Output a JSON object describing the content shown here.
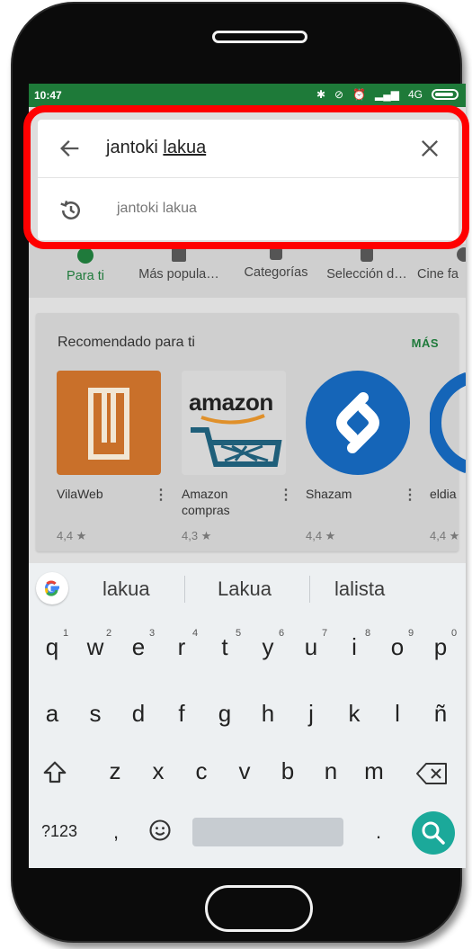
{
  "status_bar": {
    "time": "10:47",
    "network": "4G"
  },
  "search": {
    "query_prefix": "jantoki ",
    "query_underlined": "lakua",
    "suggestion": "jantoki lakua"
  },
  "tabs": [
    "Para ti",
    "Más popula…",
    "Categorías",
    "Selección d…",
    "Cine fa"
  ],
  "section": {
    "title": "Recomendado para ti",
    "more": "MÁS"
  },
  "apps": [
    {
      "name": "VilaWeb",
      "rating": "4,4 ★"
    },
    {
      "name": "Amazon compras",
      "rating": "4,3 ★",
      "logo_text": "amazon"
    },
    {
      "name": "Shazam",
      "rating": "4,4 ★"
    },
    {
      "name": "eldia",
      "rating": "4,4 ★"
    }
  ],
  "keyboard": {
    "suggestions": [
      "lakua",
      "Lakua",
      "lalista"
    ],
    "row1": [
      "q",
      "w",
      "e",
      "r",
      "t",
      "y",
      "u",
      "i",
      "o",
      "p"
    ],
    "row1_nums": [
      "1",
      "2",
      "3",
      "4",
      "5",
      "6",
      "7",
      "8",
      "9",
      "0"
    ],
    "row2": [
      "a",
      "s",
      "d",
      "f",
      "g",
      "h",
      "j",
      "k",
      "l",
      "ñ"
    ],
    "row3": [
      "z",
      "x",
      "c",
      "v",
      "b",
      "n",
      "m"
    ],
    "symbols_key": "?123",
    "comma": ",",
    "period": "."
  },
  "colors": {
    "accent": "#1f7a3b",
    "highlight": "#ff0000",
    "search_key": "#1ba99a"
  }
}
